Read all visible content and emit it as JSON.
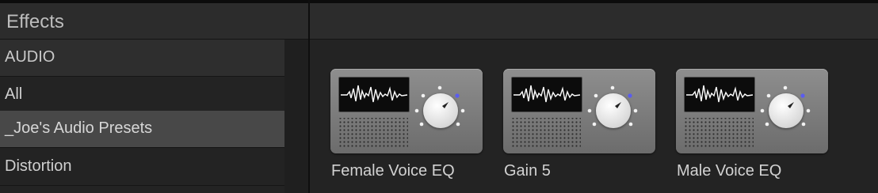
{
  "header": {
    "title": "Effects"
  },
  "sidebar": {
    "items": [
      {
        "label": "AUDIO",
        "kind": "category"
      },
      {
        "label": "All",
        "kind": "item"
      },
      {
        "label": "_Joe's Audio Presets",
        "kind": "selected"
      },
      {
        "label": "Distortion",
        "kind": "item"
      }
    ]
  },
  "effects": [
    {
      "name": "Female Voice EQ",
      "icon": "audio-effect-icon"
    },
    {
      "name": "Gain 5",
      "icon": "audio-effect-icon"
    },
    {
      "name": "Male Voice EQ",
      "icon": "audio-effect-icon"
    }
  ],
  "colors": {
    "background": "#232323",
    "selected_row": "#484848",
    "knob_indicator": "#5a5cf0"
  }
}
